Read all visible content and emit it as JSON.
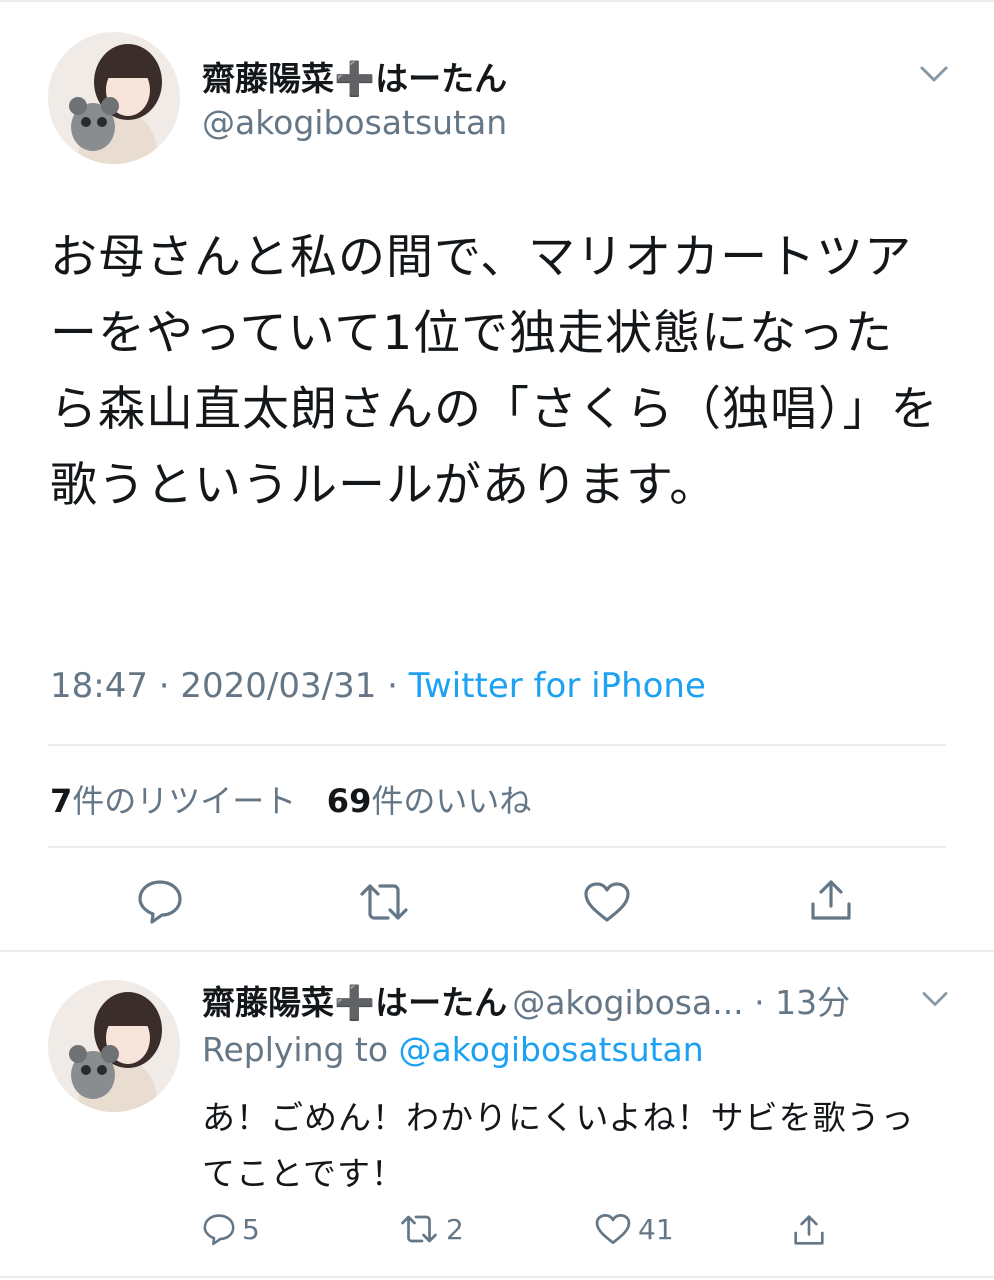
{
  "tweet": {
    "display_name": "齋藤陽菜➕はーたん",
    "handle": "@akogibosatsutan",
    "text": "お母さんと私の間で、マリオカートツアーをやっていて1位で独走状態になったら森山直太朗さんの「さくら（独唱）」を歌うというルールがあります。",
    "time": "18:47 · 2020/03/31 · ",
    "source": "Twitter for iPhone",
    "retweets_count": "7",
    "retweets_label": "件のリツイート",
    "likes_count": "69",
    "likes_label": "件のいいね"
  },
  "reply": {
    "display_name": "齋藤陽菜➕はーたん",
    "handle": "@akogibosa...",
    "time": " · 13分",
    "replying_prefix": "Replying to ",
    "replying_to": "@akogibosatsutan",
    "text": "あ！ごめん！わかりにくいよね！サビを歌うってことです！",
    "reply_count": "5",
    "retweet_count": "2",
    "like_count": "41"
  },
  "colors": {
    "text": "#14171a",
    "secondary": "#657786",
    "link": "#1da1f2",
    "divider": "#e6ecf0"
  },
  "icons": {
    "chevron": "chevron-down-icon",
    "reply": "reply-icon",
    "retweet": "retweet-icon",
    "like": "heart-icon",
    "share": "share-icon"
  }
}
